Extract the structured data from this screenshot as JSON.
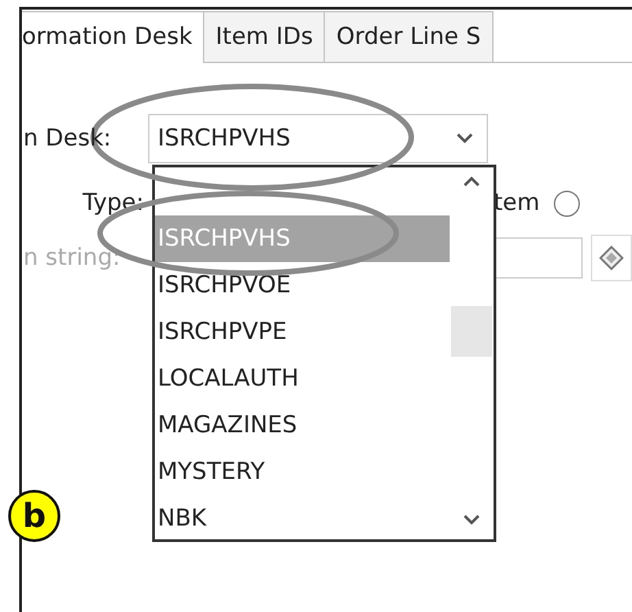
{
  "tabs": [
    {
      "label": "ormation Desk",
      "selected": true
    },
    {
      "label": "Item IDs",
      "selected": false
    },
    {
      "label": "Order Line S",
      "selected": false
    }
  ],
  "desk_field": {
    "label": "n Desk:",
    "value": "ISRCHPVHS"
  },
  "desk_list": {
    "items": [
      {
        "label": "ISRCHPVHS",
        "selected": true
      },
      {
        "label": "ISRCHPVOE",
        "selected": false
      },
      {
        "label": "ISRCHPVPE",
        "selected": false
      },
      {
        "label": "LOCALAUTH",
        "selected": false
      },
      {
        "label": "MAGAZINES",
        "selected": false
      },
      {
        "label": "MYSTERY",
        "selected": false
      },
      {
        "label": "NBK",
        "selected": false
      }
    ]
  },
  "type_row": {
    "label": "Type:",
    "option_label": "tem",
    "option_selected": false
  },
  "search_row": {
    "label": "n string:",
    "disabled": true
  },
  "callout": {
    "label": "b"
  }
}
